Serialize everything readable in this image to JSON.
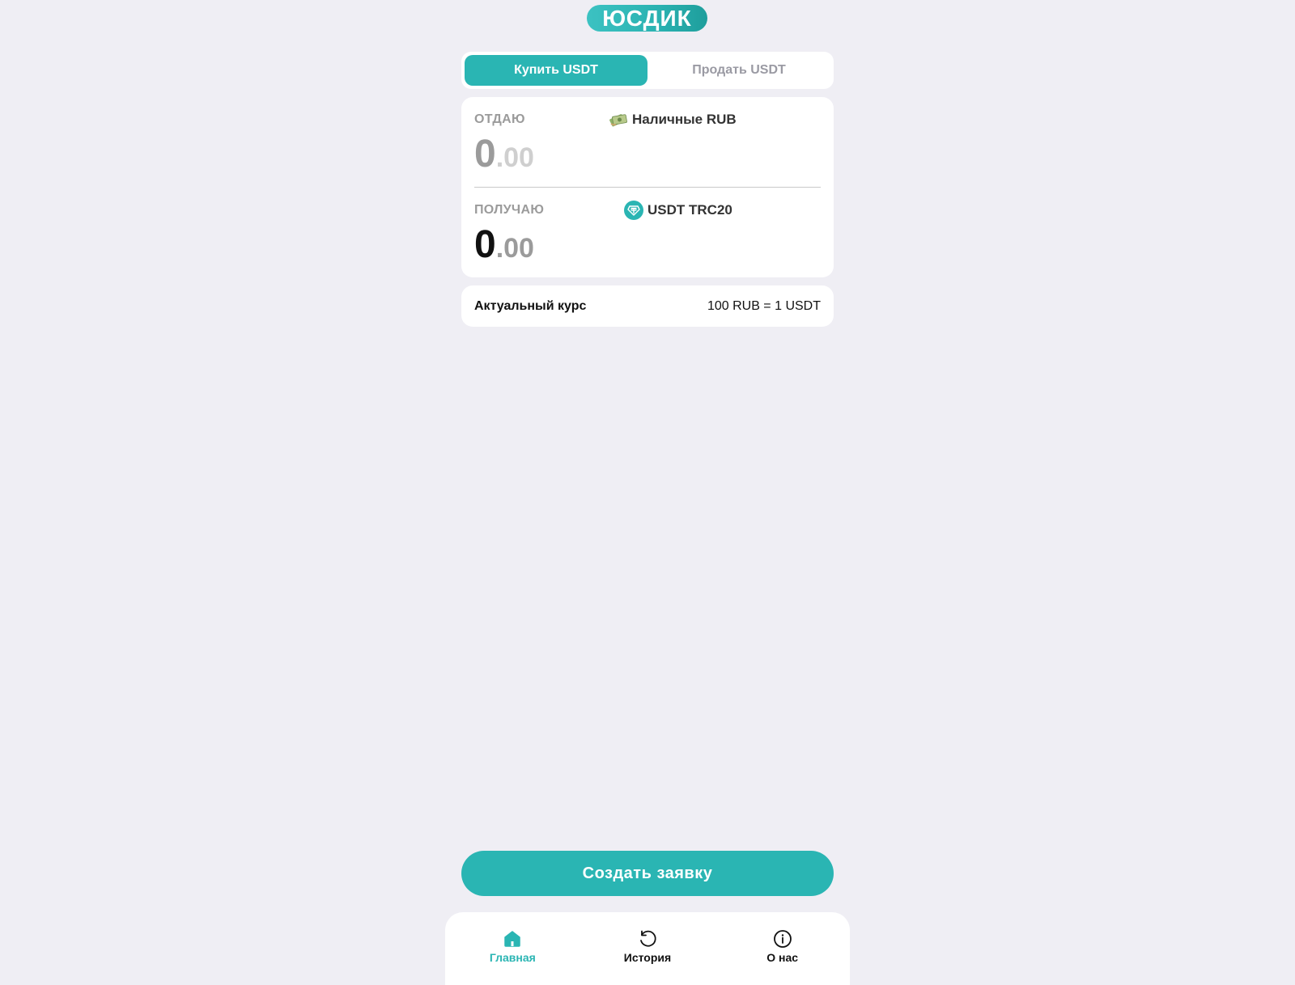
{
  "logo": {
    "text": "ЮСДИК"
  },
  "tabs": [
    {
      "label": "Купить USDT",
      "active": true
    },
    {
      "label": "Продать USDT",
      "active": false
    }
  ],
  "exchange": {
    "give": {
      "label": "ОТДАЮ",
      "amount_int": "0",
      "amount_dec": ".00",
      "currency": "Наличные RUB",
      "currency_icon": "cash-money-icon"
    },
    "get": {
      "label": "ПОЛУЧАЮ",
      "amount_int": "0",
      "amount_dec": ".00",
      "currency": "USDT TRC20",
      "currency_icon": "tether-icon"
    }
  },
  "rate": {
    "label": "Актуальный курс",
    "value": "100 RUB = 1 USDT"
  },
  "create_button": {
    "label": "Создать заявку"
  },
  "nav": [
    {
      "label": "Главная",
      "icon": "home-icon",
      "active": true
    },
    {
      "label": "История",
      "icon": "history-icon",
      "active": false
    },
    {
      "label": "О нас",
      "icon": "info-icon",
      "active": false
    }
  ],
  "colors": {
    "accent": "#2ab5b3",
    "background": "#efeef4"
  }
}
